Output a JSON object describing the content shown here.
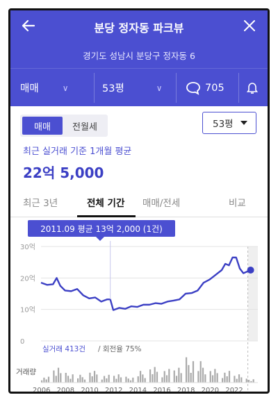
{
  "header": {
    "title": "분당 정자동 파크뷰",
    "address": "경기도 성남시 분당구 정자동 6",
    "trade_type": "매매",
    "size": "53평",
    "comment_count": "705"
  },
  "filters": {
    "trade_tab_active": "매매",
    "trade_tab_other": "전월세",
    "size_select": "53평"
  },
  "summary": {
    "caption": "최근 실거래 기준 1개월 평균",
    "price": "22억 5,000"
  },
  "period_tabs": [
    {
      "label": "최근 3년",
      "active": false
    },
    {
      "label": "전체 기간",
      "active": true
    },
    {
      "label": "매매/전세",
      "active": false
    },
    {
      "label": "비교",
      "active": false
    }
  ],
  "tooltip": "2011.09 평균 13억 2,000 (1건)",
  "stats": {
    "trades": "실거래 413건",
    "turnover": "/ 회전율 75%"
  },
  "volume_label": "거래량",
  "chart_data": {
    "type": "line",
    "y_ticks": [
      "0",
      "10억",
      "20억",
      "30억"
    ],
    "ylim": [
      0,
      30
    ],
    "x_ticks": [
      "2006",
      "2008",
      "2010",
      "2012",
      "2014",
      "2016",
      "2018",
      "2020",
      "2022"
    ],
    "xlim": [
      2006,
      2024
    ],
    "series": [
      {
        "x": [
          2006.0,
          2006.5,
          2007.0,
          2007.3,
          2007.6,
          2008.0,
          2008.5,
          2009.0,
          2009.5,
          2010.0,
          2010.5,
          2011.0,
          2011.5,
          2011.75,
          2012.0,
          2012.5,
          2013.0,
          2013.5,
          2014.0,
          2014.5,
          2015.0,
          2015.5,
          2016.0,
          2016.5,
          2017.0,
          2017.5,
          2018.0,
          2018.5,
          2019.0,
          2019.5,
          2020.0,
          2020.5,
          2021.0,
          2021.3,
          2021.6,
          2021.9,
          2022.2,
          2022.5,
          2022.8,
          2023.1,
          2023.4
        ],
        "y": [
          18.5,
          17.8,
          18.0,
          20.0,
          17.5,
          16.0,
          15.8,
          16.5,
          14.5,
          13.5,
          13.8,
          12.5,
          13.2,
          13.2,
          9.8,
          10.5,
          10.2,
          11.0,
          10.8,
          11.5,
          11.5,
          12.0,
          11.8,
          12.5,
          12.8,
          13.2,
          15.0,
          15.2,
          16.0,
          18.5,
          19.5,
          21.0,
          22.5,
          24.5,
          24.0,
          26.5,
          26.5,
          23.0,
          21.5,
          22.0,
          22.5
        ]
      }
    ],
    "highlight": {
      "x": 2011.75,
      "y": 13.2
    },
    "volume": {
      "x": [
        2006,
        2007,
        2008,
        2009,
        2010,
        2011,
        2012,
        2013,
        2014,
        2015,
        2016,
        2017,
        2018,
        2019,
        2020,
        2021,
        2022,
        2023
      ],
      "values": [
        3,
        9,
        5,
        4,
        6,
        4,
        5,
        3,
        6,
        8,
        7,
        9,
        13,
        11,
        7,
        6,
        5,
        2
      ]
    },
    "colors": {
      "line": "#3b3fc4",
      "future_band": "#efefef"
    }
  }
}
